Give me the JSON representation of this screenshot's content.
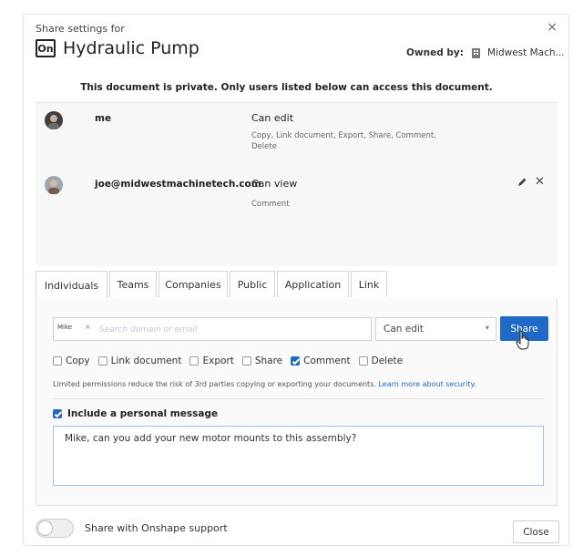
{
  "header": {
    "label": "Share settings for",
    "logo_text": "On",
    "title": "Hydraulic Pump",
    "owned_by_label": "Owned by:",
    "owner": "Midwest Mach...",
    "close": "×"
  },
  "privacy_notice": "This document is private. Only users listed below can access this document.",
  "users": [
    {
      "name": "me",
      "permission": "Can edit",
      "details": "Copy, Link document, Export, Share, Comment, Delete",
      "avatar_color": "#4a4a4a"
    },
    {
      "name": "joe@midwestmachinetech.com",
      "permission": "Can view",
      "details": "Comment",
      "avatar_color": "#8a7a6a"
    }
  ],
  "tabs": [
    {
      "label": "Individuals",
      "active": true
    },
    {
      "label": "Teams",
      "active": false
    },
    {
      "label": "Companies",
      "active": false
    },
    {
      "label": "Public",
      "active": false
    },
    {
      "label": "Application",
      "active": false
    },
    {
      "label": "Link",
      "active": false
    }
  ],
  "invite": {
    "chip": "Mike",
    "chip_remove": "×",
    "placeholder": "Search domain or email"
  },
  "permission_select": {
    "value": "Can edit",
    "caret": "▾"
  },
  "share_button": "Share",
  "permissions": [
    {
      "label": "Copy",
      "checked": false
    },
    {
      "label": "Link document",
      "checked": false
    },
    {
      "label": "Export",
      "checked": false
    },
    {
      "label": "Share",
      "checked": false
    },
    {
      "label": "Comment",
      "checked": true
    },
    {
      "label": "Delete",
      "checked": false
    }
  ],
  "limited_note": "Limited permissions reduce the risk of 3rd parties copying or exporting your documents.",
  "learn_more": "Learn more about security.",
  "personal_message": {
    "label": "Include a personal message",
    "checked": true,
    "text": "Mike, can you add your new motor mounts to this assembly?"
  },
  "support": {
    "label": "Share with Onshape support",
    "enabled": false
  },
  "close_button": "Close",
  "colors": {
    "accent": "#1f6ac6",
    "panel_bg": "#f7f7f7"
  }
}
